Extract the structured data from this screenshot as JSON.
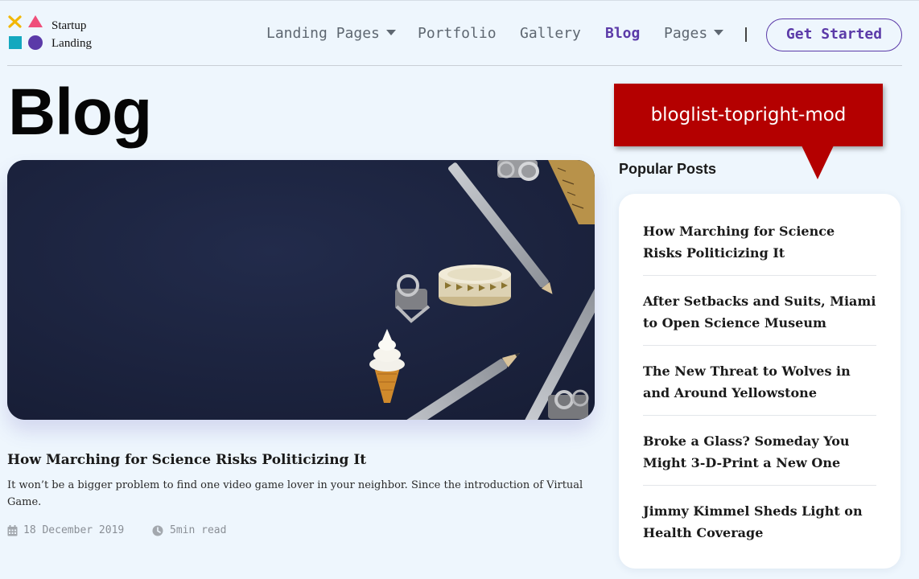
{
  "logo": {
    "line1": "Startup",
    "line2": "Landing",
    "colors": {
      "x": "#f2b705",
      "triangle": "#ef4f7a",
      "square": "#14a8bf",
      "circle": "#5b3aa8"
    }
  },
  "nav": {
    "items": [
      {
        "label": "Landing Pages",
        "dropdown": true,
        "active": false
      },
      {
        "label": "Portfolio",
        "dropdown": false,
        "active": false
      },
      {
        "label": "Gallery",
        "dropdown": false,
        "active": false
      },
      {
        "label": "Blog",
        "dropdown": false,
        "active": true
      },
      {
        "label": "Pages",
        "dropdown": true,
        "active": false
      }
    ],
    "separator": "|",
    "cta_label": "Get Started"
  },
  "page": {
    "title": "Blog"
  },
  "featured_post": {
    "image_icon": "desk-flatlay-image",
    "title": "How Marching for Science Risks Politicizing It",
    "excerpt": "It won’t be a bigger problem to find one video game lover in your neighbor. Since the introduction of Virtual Game.",
    "date": "18 December 2019",
    "read_time": "5min read",
    "date_icon": "calendar-icon",
    "time_icon": "clock-icon"
  },
  "annotation": {
    "label": "bloglist-topright-mod",
    "color": "#b40000"
  },
  "sidebar": {
    "heading": "Popular Posts",
    "posts": [
      "How Marching for Science Risks Politicizing It",
      "After Setbacks and Suits, Miami to Open Science Museum",
      "The New Threat to Wolves in and Around Yellowstone",
      "Broke a Glass? Someday You Might 3-D-Print a New One",
      "Jimmy Kimmel Sheds Light on Health Coverage"
    ]
  },
  "theme": {
    "accent": "#5b3aa8",
    "background": "#eef6fd"
  }
}
